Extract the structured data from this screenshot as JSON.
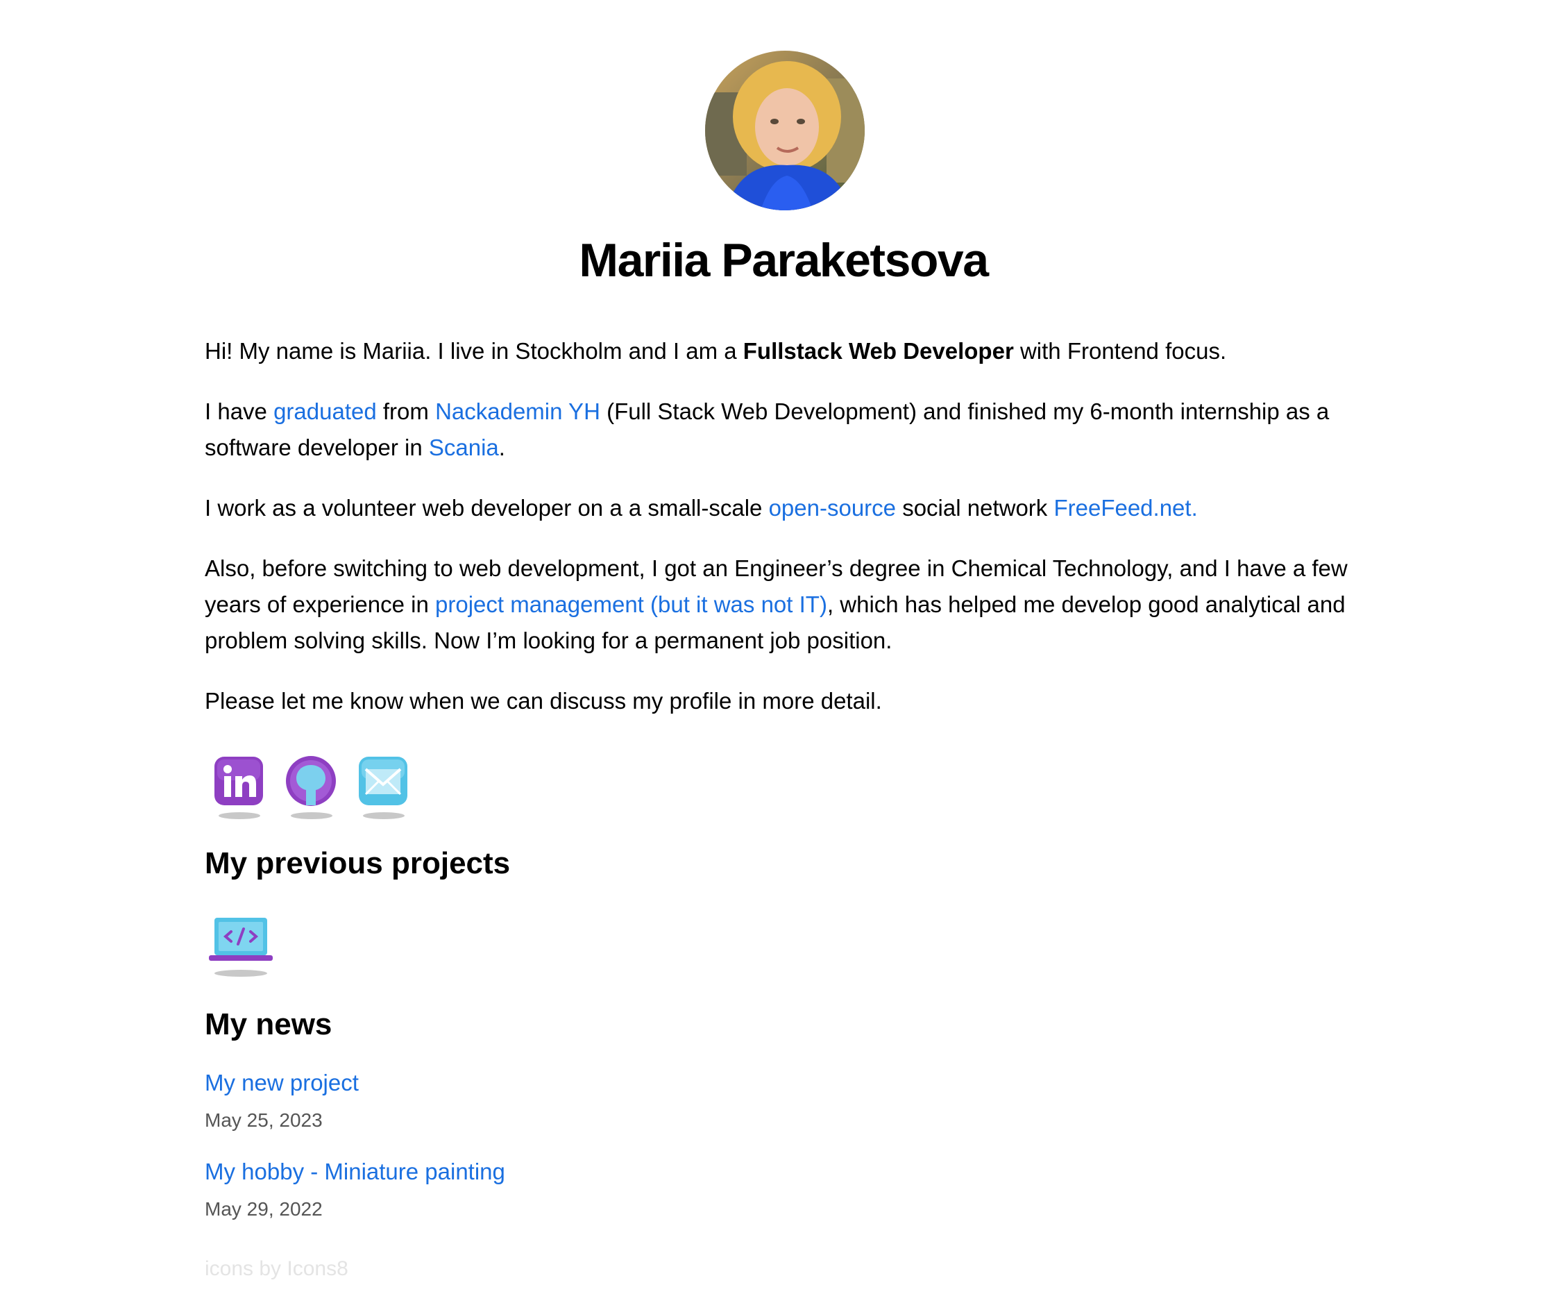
{
  "profile": {
    "name": "Mariia Paraketsova"
  },
  "intro": {
    "p1_before": "Hi! My name is Mariia. I live in Stockholm and I am a ",
    "p1_bold": "Fullstack Web Developer",
    "p1_after": " with Frontend focus.",
    "p2_before": "I have ",
    "p2_link1": "graduated",
    "p2_mid1": " from ",
    "p2_link2": "Nackademin YH",
    "p2_mid2": " (Full Stack Web Development) and finished my 6-month internship as a software developer in ",
    "p2_link3": "Scania",
    "p2_after": ".",
    "p3_before": "I work as a volunteer web developer on a a small-scale ",
    "p3_link1": "open-source",
    "p3_mid": " social network ",
    "p3_link2": "FreeFeed.net.",
    "p4_before": "Also, before switching to web development, I got an Engineer’s degree in Chemical Technology, and I have a few years of experience in ",
    "p4_link": "project management (but it was not IT)",
    "p4_after": ", which has helped me develop good analytical and problem solving skills. Now I’m looking for a permanent job position.",
    "p5": "Please let me know when we can discuss my profile in more detail."
  },
  "social": [
    {
      "icon": "linkedin-icon",
      "color": "#8e3fc2"
    },
    {
      "icon": "github-icon",
      "color": "#8e3fc2"
    },
    {
      "icon": "mail-icon",
      "color": "#52c2e6"
    }
  ],
  "projects": {
    "title": "My previous projects",
    "icon": "laptop-code-icon"
  },
  "news": {
    "title": "My news",
    "items": [
      {
        "title": "My new project",
        "date": "May 25, 2023"
      },
      {
        "title": "My hobby - Miniature painting",
        "date": "May 29, 2022"
      }
    ]
  },
  "footer": {
    "credit": "icons by Icons8"
  },
  "colors": {
    "link": "#1a6fe0",
    "accent_purple": "#8e3fc2",
    "accent_cyan": "#52c2e6"
  }
}
